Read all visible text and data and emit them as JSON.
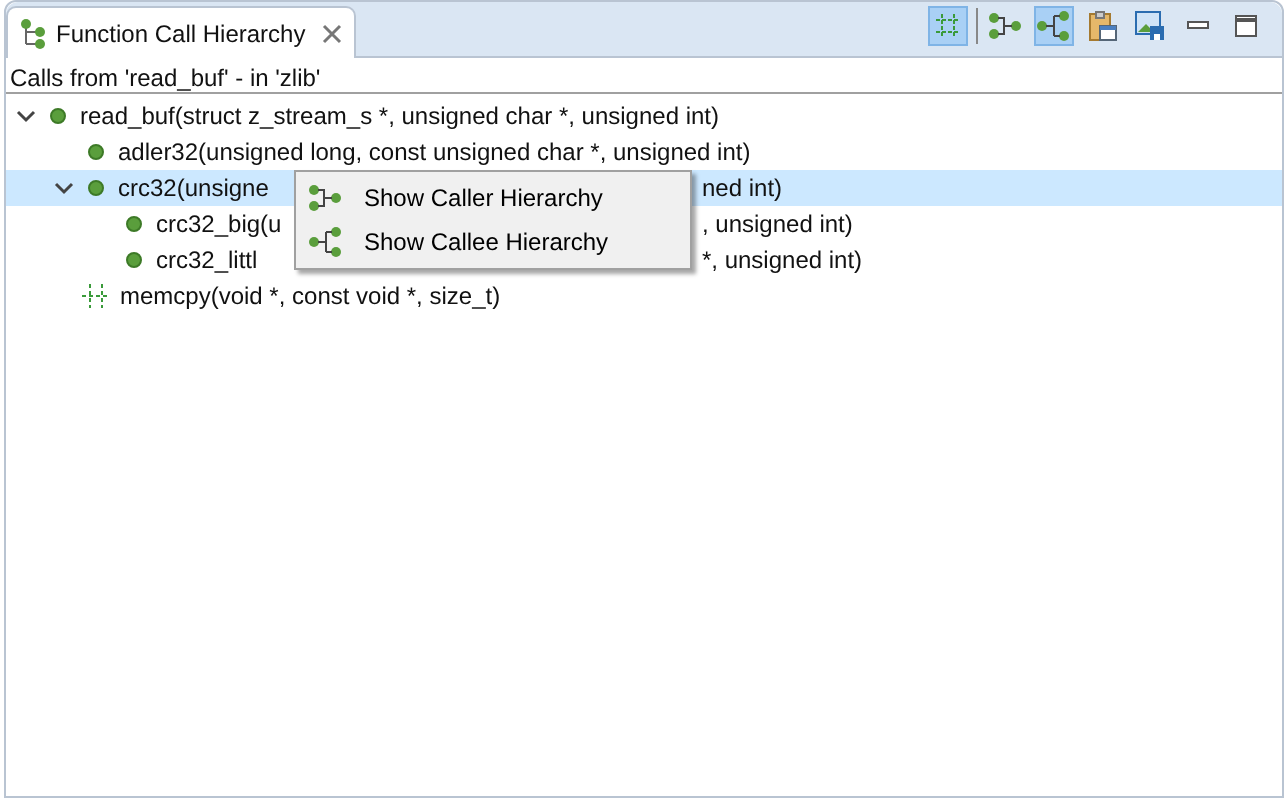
{
  "tab": {
    "title": "Function Call Hierarchy",
    "selected": true
  },
  "toolbar": [
    {
      "kind": "layout",
      "pressed": true
    },
    {
      "kind": "separator"
    },
    {
      "kind": "caller",
      "pressed": false
    },
    {
      "kind": "callee",
      "pressed": true
    },
    {
      "kind": "history",
      "pressed": false
    },
    {
      "kind": "pin",
      "pressed": false
    },
    {
      "kind": "minimize",
      "pressed": false
    },
    {
      "kind": "maximize",
      "pressed": false
    }
  ],
  "header": "Calls from 'read_buf' - in 'zlib'",
  "tree": [
    {
      "text": "read_buf(struct z_stream_s *, unsigned char *, unsigned int)",
      "kind": "function",
      "expanded": true,
      "selected": false,
      "children": [
        {
          "text": "adler32(unsigned long, const unsigned char *, unsigned int)",
          "kind": "function",
          "selected": false
        },
        {
          "text": "crc32(unsigne",
          "text_after": "ned int)",
          "kind": "function",
          "expanded": true,
          "selected": true,
          "children": [
            {
              "text": "crc32_big(u",
              "text_after": ", unsigned int)",
              "kind": "function",
              "selected": false
            },
            {
              "text": "crc32_littl",
              "text_after": "*, unsigned int)",
              "kind": "function",
              "selected": false
            }
          ]
        },
        {
          "text": "memcpy(void *, const void *, size_t)",
          "kind": "external",
          "selected": false
        }
      ]
    }
  ],
  "context_menu": [
    {
      "label": "Show Caller Hierarchy",
      "kind": "caller"
    },
    {
      "label": "Show Callee Hierarchy",
      "kind": "callee"
    }
  ]
}
